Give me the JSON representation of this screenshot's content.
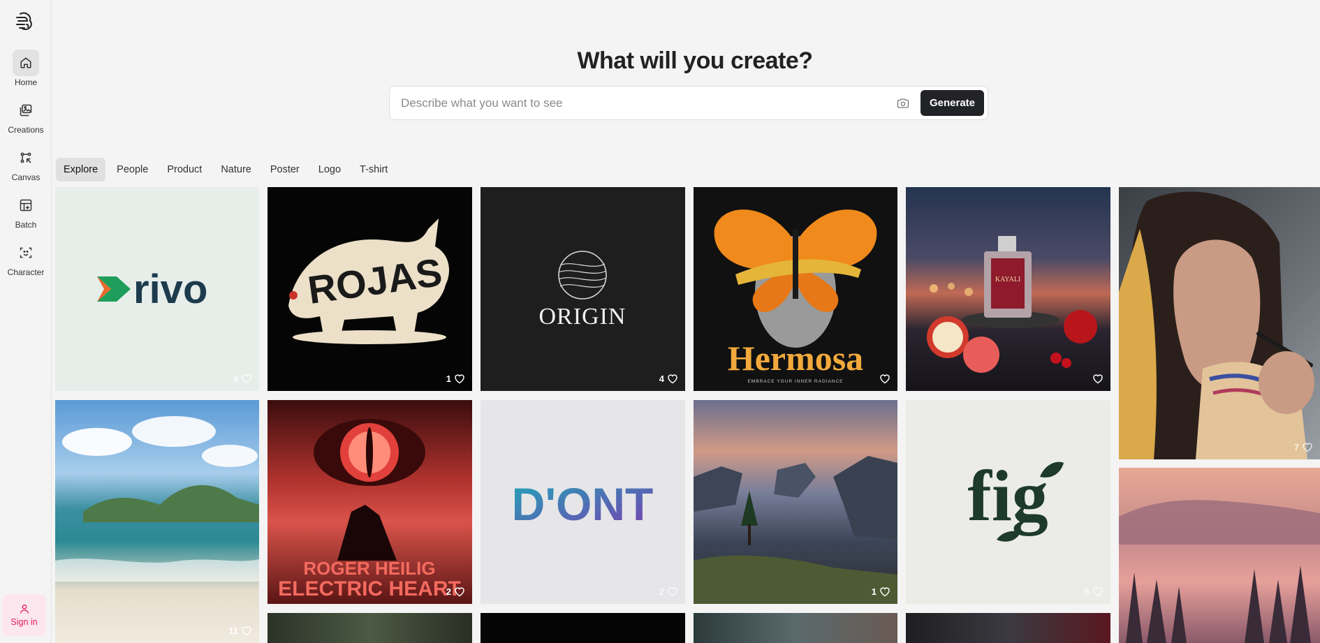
{
  "nav": {
    "items": [
      {
        "label": "Home",
        "icon": "home-icon",
        "active": true
      },
      {
        "label": "Creations",
        "icon": "images-icon"
      },
      {
        "label": "Canvas",
        "icon": "canvas-icon"
      },
      {
        "label": "Batch",
        "icon": "batch-icon"
      },
      {
        "label": "Character",
        "icon": "character-icon"
      }
    ],
    "signin_label": "Sign in"
  },
  "hero": {
    "title": "What will you create?",
    "placeholder": "Describe what you want to see",
    "generate_label": "Generate"
  },
  "tabs": [
    "Explore",
    "People",
    "Product",
    "Nature",
    "Poster",
    "Logo",
    "T-shirt"
  ],
  "gallery": [
    {
      "name": "rivo-logo",
      "text": "rivo",
      "likes": "4"
    },
    {
      "name": "rojas-rhino",
      "text": "ROJAS",
      "likes": "1"
    },
    {
      "name": "origin-logo",
      "text": "ORIGIN",
      "likes": "4"
    },
    {
      "name": "hermosa-poster",
      "text": "Hermosa",
      "subtext": "EMBRACE YOUR INNER RADIANCE",
      "likes": ""
    },
    {
      "name": "kayali-perfume",
      "text": "KAYALI",
      "likes": ""
    },
    {
      "name": "woman-scarf",
      "likes": "7"
    },
    {
      "name": "beach-scene",
      "likes": "11"
    },
    {
      "name": "roger-heilig-poster",
      "text": "ROGER HEILIG",
      "subtext": "ELECTRIC HEART",
      "likes": "2"
    },
    {
      "name": "dont-logo",
      "text": "D'ONT",
      "likes": "2"
    },
    {
      "name": "fjord-sunset",
      "likes": "1"
    },
    {
      "name": "fig-logo",
      "text": "fig",
      "likes": "5"
    },
    {
      "name": "misty-forest",
      "likes": ""
    }
  ],
  "colors": {
    "accent_pink": "#e0195c",
    "button_dark": "#222326"
  }
}
